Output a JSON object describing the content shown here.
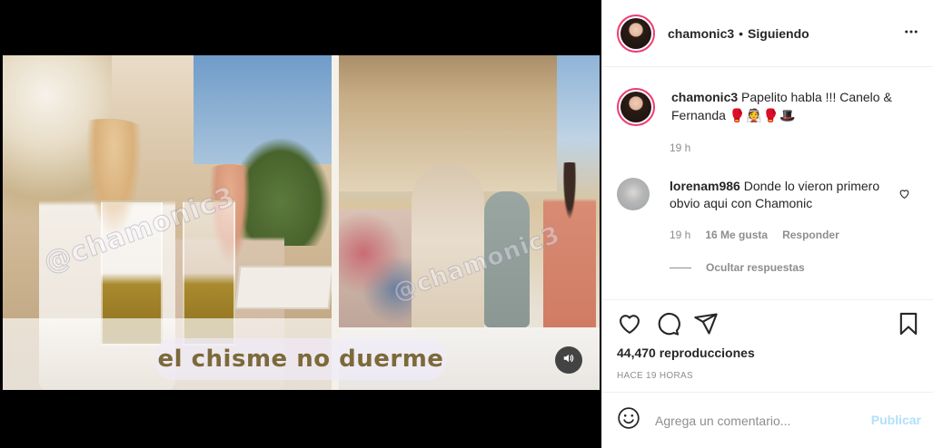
{
  "media": {
    "watermark": "@chamonic3",
    "caption_overlay": "el chisme no duerme",
    "mute_icon": "speaker-icon"
  },
  "header": {
    "username": "chamonic3",
    "separator": "•",
    "follow_status": "Siguiendo",
    "more_icon": "more-horizontal-icon"
  },
  "caption": {
    "username": "chamonic3",
    "text": "Papelito habla !!! Canelo & Fernanda",
    "emojis": "🥊👰🥊🎩",
    "time": "19 h"
  },
  "reply": {
    "username": "lorenam986",
    "text": "Donde lo vieron primero obvio aqui con Chamonic",
    "time": "19 h",
    "likes": "16 Me gusta",
    "reply_label": "Responder",
    "hide_label": "Ocultar respuestas"
  },
  "actions": {
    "icons": [
      "heart-icon",
      "comment-icon",
      "share-icon",
      "bookmark-icon"
    ],
    "views": "44,470 reproducciones",
    "ago": "HACE 19 HORAS"
  },
  "add_comment": {
    "placeholder": "Agrega un comentario...",
    "post_label": "Publicar"
  },
  "colors": {
    "story_ring": "#ef3b75",
    "post_disabled": "#b2dffc",
    "secondary_text": "#8e8e8e",
    "border": "#efefef"
  }
}
